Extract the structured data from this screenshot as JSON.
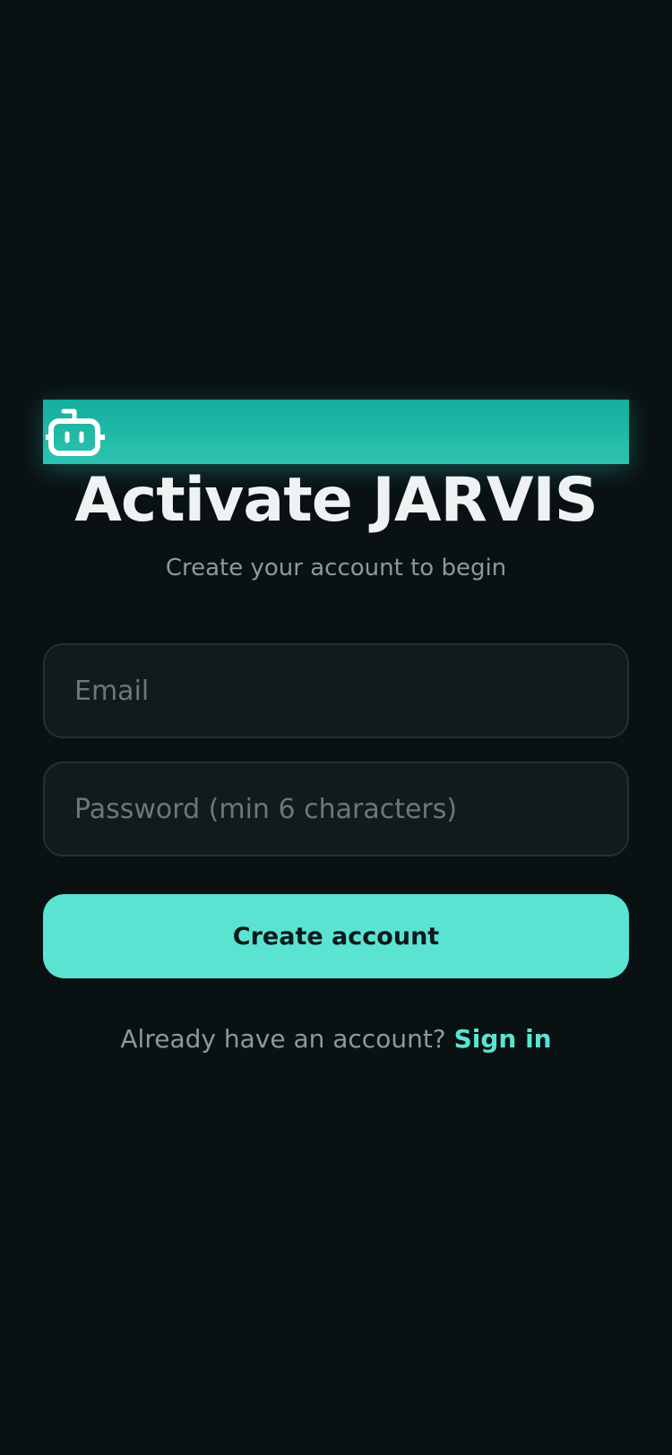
{
  "logo": {
    "icon": "robot-icon",
    "banner_color": "#1ab5a2"
  },
  "header": {
    "title": "Activate JARVIS",
    "subtitle": "Create your account to begin"
  },
  "form": {
    "email_placeholder": "Email",
    "email_value": "",
    "password_placeholder": "Password (min 6 characters)",
    "password_value": "",
    "submit_label": "Create account"
  },
  "footer": {
    "prompt": "Already have an account?",
    "signin_label": "Sign in"
  },
  "colors": {
    "background": "#0a1113",
    "accent": "#5be3d2",
    "text_primary": "#eef2f2",
    "text_muted": "#8e9899"
  }
}
